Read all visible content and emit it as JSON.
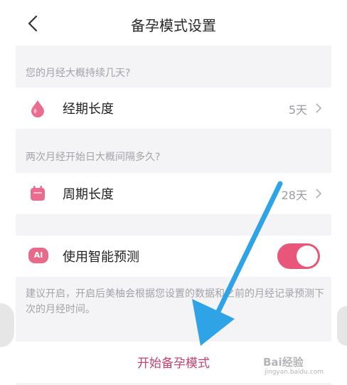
{
  "header": {
    "title": "备孕模式设置"
  },
  "period": {
    "question": "您的月经大概持续几天?",
    "label": "经期长度",
    "value": "5天"
  },
  "cycle": {
    "question": "两次月经开始日大概间隔多久?",
    "label": "周期长度",
    "value": "28天"
  },
  "prediction": {
    "badge": "AI",
    "label": "使用智能预测",
    "enabled": true,
    "hint": "建议开启，开启后美柚会根据您设置的数据和之前的月经记录预测下次的月经时间。"
  },
  "start_button": {
    "label": "开始备孕模式"
  },
  "watermark": {
    "line1": "Bai经验",
    "line2": "jingyan.baidu.com"
  },
  "colors": {
    "accent": "#e8567a",
    "start_text": "#c7416a",
    "arrow": "#2ea3e6",
    "background": "#f4f3f6"
  }
}
